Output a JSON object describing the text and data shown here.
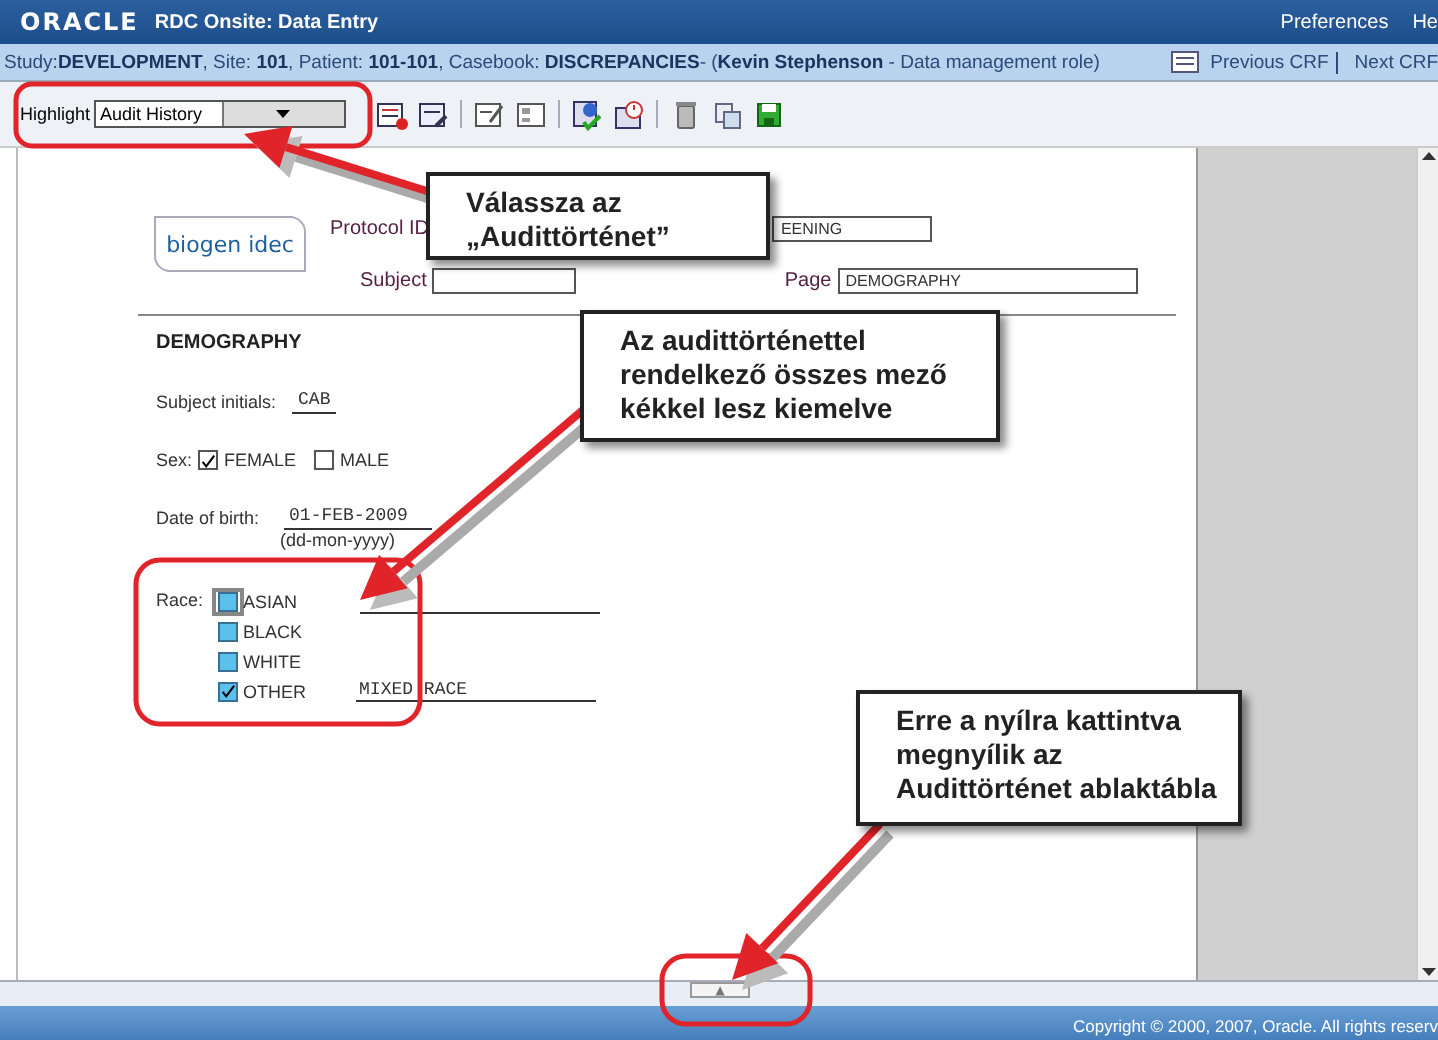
{
  "header": {
    "logo": "ORACLE",
    "title": "RDC Onsite: Data Entry",
    "links": [
      "Preferences",
      "He"
    ]
  },
  "context_bar": {
    "info": "Study:**DEVELOPMENT**, Site: **101**, Patient: **101-101**, Casebook: **DISCREPANCIES**- (**Kevin Stephenson** - Data management role)",
    "nav": [
      "Previous CRF",
      "Next CRF"
    ]
  },
  "toolbar": {
    "highlight_label": "Highlight",
    "highlight_value": "Audit History"
  },
  "form": {
    "logo": "biogen idec",
    "protocol_label": "Protocol ID",
    "protocol_value": "EENING",
    "subject_label": "Subject",
    "page_label": "Page",
    "page_value": "DEMOGRAPHY",
    "section": "DEMOGRAPHY",
    "initials_label": "Subject initials:",
    "initials_value": "CAB",
    "sex_label": "Sex:",
    "sex_options": [
      {
        "label": "FEMALE",
        "checked": true
      },
      {
        "label": "MALE",
        "checked": false
      }
    ],
    "dob_label": "Date of birth:",
    "dob_value": "01-FEB-2009",
    "dob_hint": "(dd-mon-yyyy)",
    "race_label": "Race:",
    "race_options": [
      {
        "label": "ASIAN",
        "checked": false,
        "audit_history": true,
        "focused": true
      },
      {
        "label": "BLACK",
        "checked": false,
        "audit_history": true,
        "focused": false
      },
      {
        "label": "WHITE",
        "checked": false,
        "audit_history": true,
        "focused": false
      },
      {
        "label": "OTHER",
        "checked": true,
        "audit_history": true,
        "focused": false,
        "specify": "MIXED RACE"
      }
    ]
  },
  "audit_pane_toggle": "▲",
  "footer": "Copyright © 2000, 2007, Oracle. All rights reserv",
  "callouts": [
    {
      "lines": [
        "Válassza az",
        "„Audittörténet”"
      ]
    },
    {
      "lines": [
        "Az audittörténettel",
        "rendelkező összes mező",
        "kékkel lesz kiemelve"
      ]
    },
    {
      "lines": [
        "Erre a nyílra kattintva",
        "megnyílik az",
        "Audittörténet ablaktábla"
      ]
    }
  ]
}
